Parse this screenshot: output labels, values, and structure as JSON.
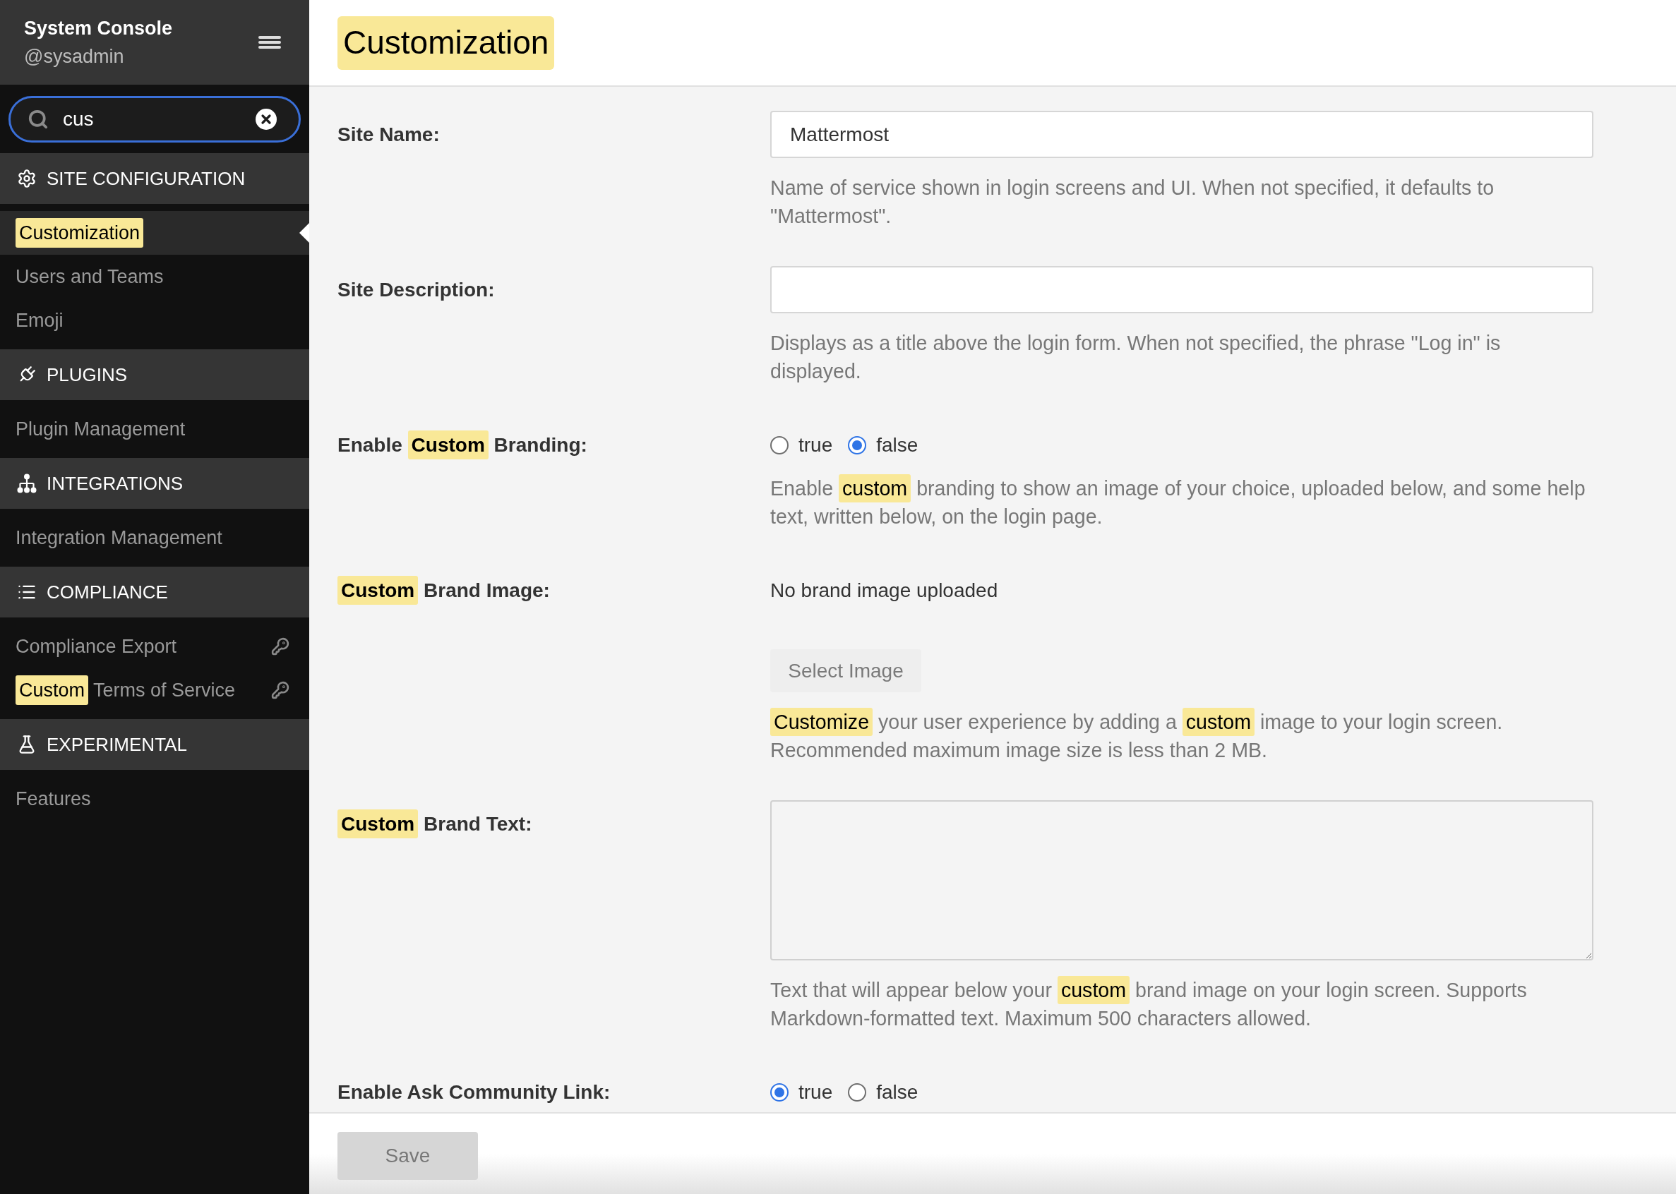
{
  "sidebar": {
    "header": {
      "title": "System Console",
      "username": "@sysadmin"
    },
    "search": {
      "value": "cus"
    },
    "sections": [
      {
        "title": "SITE CONFIGURATION",
        "items": [
          {
            "segments": [
              {
                "text": "Customization",
                "highlighted": true
              }
            ],
            "selected": true,
            "locked": false
          },
          {
            "segments": [
              {
                "text": "Users and Teams",
                "highlighted": false
              }
            ],
            "selected": false,
            "locked": false
          },
          {
            "segments": [
              {
                "text": "Emoji",
                "highlighted": false
              }
            ],
            "selected": false,
            "locked": false
          }
        ]
      },
      {
        "title": "PLUGINS",
        "items": [
          {
            "segments": [
              {
                "text": "Plugin Management",
                "highlighted": false
              }
            ],
            "selected": false,
            "locked": false
          }
        ]
      },
      {
        "title": "INTEGRATIONS",
        "items": [
          {
            "segments": [
              {
                "text": "Integration Management",
                "highlighted": false
              }
            ],
            "selected": false,
            "locked": false
          }
        ]
      },
      {
        "title": "COMPLIANCE",
        "items": [
          {
            "segments": [
              {
                "text": "Compliance Export",
                "highlighted": false
              }
            ],
            "selected": false,
            "locked": true
          },
          {
            "segments": [
              {
                "text": "Custom",
                "highlighted": true
              },
              {
                "text": "Terms of Service",
                "highlighted": false
              }
            ],
            "selected": false,
            "locked": true
          }
        ]
      },
      {
        "title": "EXPERIMENTAL",
        "items": [
          {
            "segments": [
              {
                "text": "Features",
                "highlighted": false
              }
            ],
            "selected": false,
            "locked": false
          }
        ]
      }
    ]
  },
  "page": {
    "title": {
      "text": "Customization",
      "highlighted": true
    },
    "settings": [
      {
        "kind": "text",
        "label": [
          {
            "text": "Site Name:",
            "highlighted": false
          }
        ],
        "value": "Mattermost",
        "help": [
          {
            "text": "Name of service shown in login screens and UI. When not specified, it defaults to \"Mattermost\".",
            "highlighted": false
          }
        ]
      },
      {
        "kind": "text",
        "label": [
          {
            "text": "Site Description:",
            "highlighted": false
          }
        ],
        "help": [
          {
            "text": "Displays as a title above the login form. When not specified, the phrase \"Log in\" is displayed.",
            "highlighted": false
          }
        ]
      },
      {
        "kind": "radio",
        "label": [
          {
            "text": "Enable",
            "highlighted": false
          },
          {
            "text": "Custom",
            "highlighted": true
          },
          {
            "text": "Branding:",
            "highlighted": false
          }
        ],
        "options": [
          {
            "label": "true",
            "selected": false
          },
          {
            "label": "false",
            "selected": true
          }
        ],
        "help": [
          {
            "text": "Enable",
            "highlighted": false
          },
          {
            "text": "custom",
            "highlighted": true
          },
          {
            "text": "branding to show an image of your choice, uploaded below, and some help text, written below, on the login page.",
            "highlighted": false
          }
        ]
      },
      {
        "kind": "image",
        "label": [
          {
            "text": "Custom",
            "highlighted": true
          },
          {
            "text": "Brand Image:",
            "highlighted": false
          }
        ],
        "status": "No brand image uploaded",
        "button": {
          "label": "Select Image",
          "disabled": true
        },
        "help": [
          {
            "text": "Customize",
            "highlighted": true
          },
          {
            "text": "your user experience by adding a",
            "highlighted": false
          },
          {
            "text": "custom",
            "highlighted": true
          },
          {
            "text": "image to your login screen. Recommended maximum image size is less than 2 MB.",
            "highlighted": false
          }
        ]
      },
      {
        "kind": "textarea",
        "label": [
          {
            "text": "Custom",
            "highlighted": true
          },
          {
            "text": "Brand Text:",
            "highlighted": false
          }
        ],
        "help": [
          {
            "text": "Text that will appear below your",
            "highlighted": false
          },
          {
            "text": "custom",
            "highlighted": true
          },
          {
            "text": "brand image on your login screen. Supports Markdown-formatted text. Maximum 500 characters allowed.",
            "highlighted": false
          }
        ]
      },
      {
        "kind": "radio",
        "label": [
          {
            "text": "Enable Ask Community Link:",
            "highlighted": false
          }
        ],
        "options": [
          {
            "label": "true",
            "selected": true
          },
          {
            "label": "false",
            "selected": false
          }
        ]
      }
    ]
  },
  "footer": {
    "save_button": {
      "label": "Save",
      "disabled": true
    }
  }
}
